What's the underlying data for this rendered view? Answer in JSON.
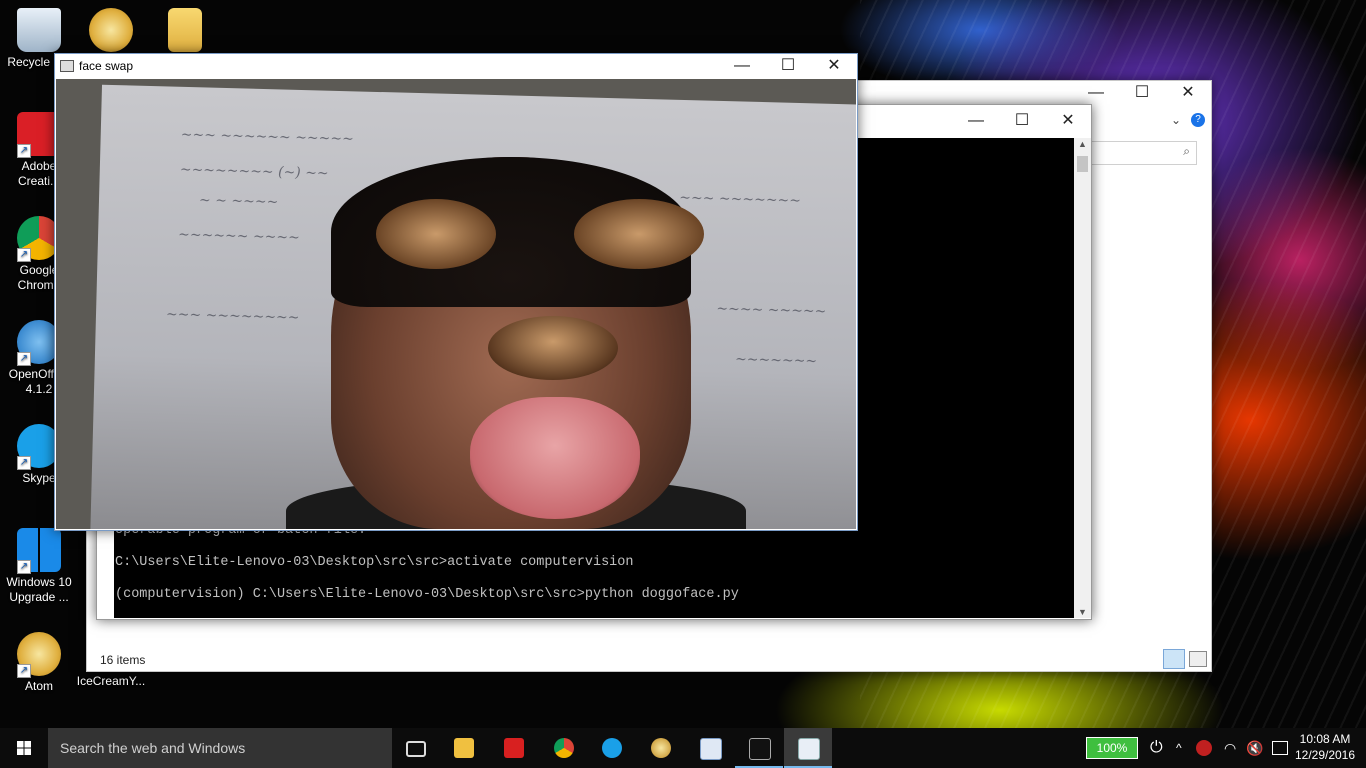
{
  "desktop": {
    "icons": [
      {
        "label": "Recycle Bin",
        "icon": "recycle-bin-icon"
      },
      {
        "label": "",
        "icon": "atom-icon"
      },
      {
        "label": "",
        "icon": "folder-icon"
      },
      {
        "label": "Adobe Creati...",
        "icon": "adobe-creative-cloud-icon"
      },
      {
        "label": "Google Chrome",
        "icon": "chrome-icon"
      },
      {
        "label": "OpenOffice 4.1.2",
        "icon": "openoffice-icon"
      },
      {
        "label": "Skype",
        "icon": "skype-icon"
      },
      {
        "label": "Windows 10 Upgrade ...",
        "icon": "windows10-upgrade-icon"
      },
      {
        "label": "Atom",
        "icon": "atom-icon"
      },
      {
        "label": "IceCreamY...",
        "icon": "icecream-icon"
      }
    ]
  },
  "explorer": {
    "status": "16 items",
    "controls": {
      "minimize": "—",
      "maximize": "☐",
      "close": "✕"
    }
  },
  "cmd": {
    "lines": [
      "operable program or batch file.",
      "",
      "C:\\Users\\Elite-Lenovo-03\\Desktop\\src\\src>activate computervision",
      "",
      "(computervision) C:\\Users\\Elite-Lenovo-03\\Desktop\\src\\src>python doggoface.py"
    ],
    "controls": {
      "minimize": "—",
      "maximize": "☐",
      "close": "✕"
    }
  },
  "faceswap": {
    "title": "face swap",
    "controls": {
      "minimize": "—",
      "maximize": "☐",
      "close": "✕"
    }
  },
  "taskbar": {
    "search_placeholder": "Search the web and Windows",
    "battery": "100%",
    "time": "10:08 AM",
    "date": "12/29/2016",
    "pinned": [
      {
        "icon": "task-view-icon"
      },
      {
        "icon": "file-explorer-icon"
      },
      {
        "icon": "app-red-icon"
      },
      {
        "icon": "chrome-icon"
      },
      {
        "icon": "skype-icon"
      },
      {
        "icon": "atom-icon"
      },
      {
        "icon": "document-icon"
      },
      {
        "icon": "cmd-icon"
      },
      {
        "icon": "explorer-window-icon"
      }
    ]
  },
  "colors": {
    "taskbar": "#0c0c0c",
    "accent": "#1a73e8",
    "battery": "#3fbf3f"
  }
}
